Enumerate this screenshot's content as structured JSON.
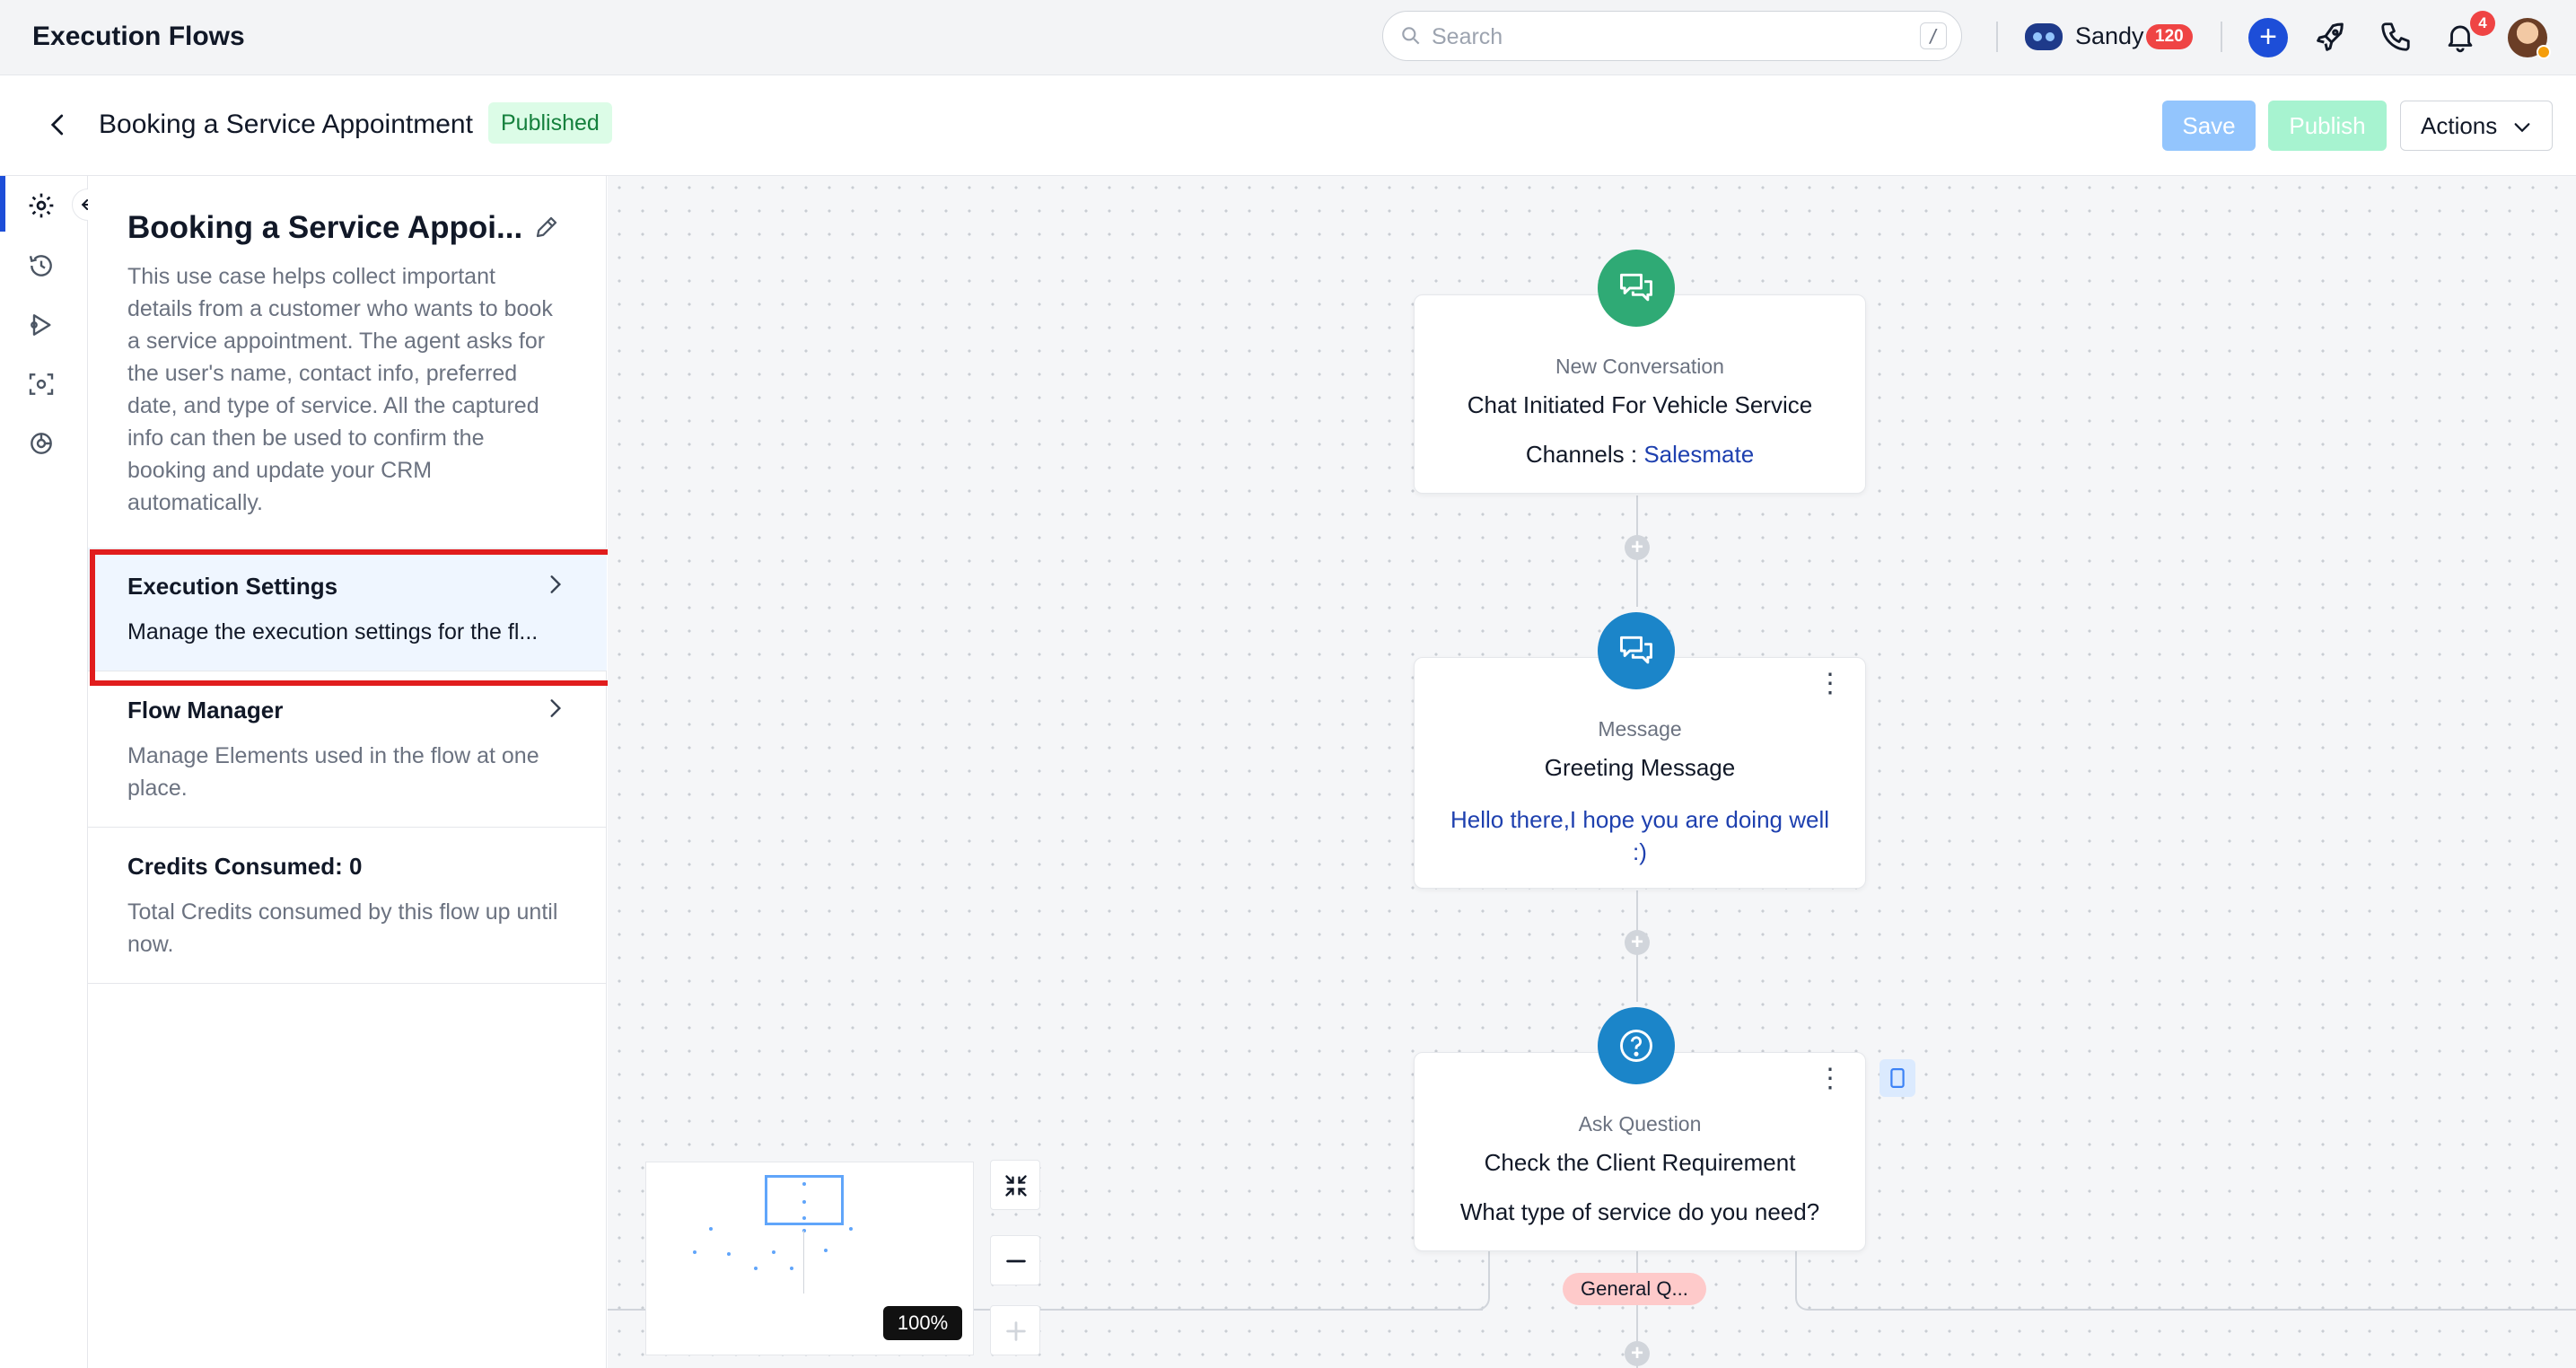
{
  "app": {
    "title": "Execution Flows"
  },
  "search": {
    "placeholder": "Search",
    "shortcut": "/"
  },
  "user": {
    "name": "Sandy",
    "badge": "120",
    "notifications": "4"
  },
  "header": {
    "title": "Booking a Service Appointment",
    "status": "Published",
    "save_label": "Save",
    "publish_label": "Publish",
    "actions_label": "Actions"
  },
  "rail": {
    "items": [
      "settings-icon",
      "history-icon",
      "run-flow-icon",
      "preview-icon",
      "integrations-icon"
    ]
  },
  "panel": {
    "flow_name": "Booking a Service Appoi...",
    "description": "This use case helps collect important details from a customer who wants to book a service appointment. The agent asks for the user's name, contact info, preferred date, and type of service. All the captured info can then be used to confirm the booking and update your CRM automatically.",
    "execution_settings": {
      "title": "Execution Settings",
      "text": "Manage the execution settings for the fl..."
    },
    "flow_manager": {
      "title": "Flow Manager",
      "text": "Manage Elements used in the flow at one place."
    },
    "credits": {
      "title": "Credits Consumed: 0",
      "text": "Total Credits consumed by this flow up until now."
    }
  },
  "nodes": {
    "start": {
      "type": "New Conversation",
      "title": "Chat Initiated For Vehicle Service",
      "channels_label": "Channels : ",
      "channel": "Salesmate",
      "color": "#2faa75"
    },
    "message": {
      "type": "Message",
      "title": "Greeting Message",
      "text": "Hello there,I hope you are doing well :)",
      "color": "#1b85c9"
    },
    "question": {
      "type": "Ask Question",
      "title": "Check the Client Requirement",
      "text": "What type of service do you need?",
      "color": "#1b85c9",
      "branch": "General Q..."
    }
  },
  "zoom": {
    "level": "100%"
  },
  "colors": {
    "accent": "#1d4ed8",
    "highlight": "#e11d1d",
    "published_bg": "#dcfce7"
  }
}
